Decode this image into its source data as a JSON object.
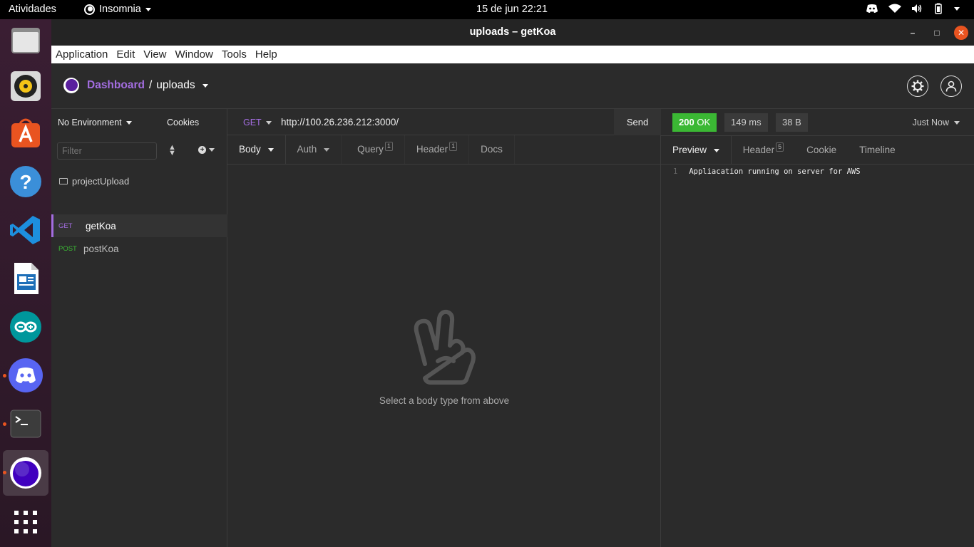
{
  "topbar": {
    "activities": "Atividades",
    "app_name": "Insomnia",
    "clock": "15 de jun  22:21"
  },
  "dock": {
    "items": [
      "files-icon",
      "rhythmbox-icon",
      "software-icon",
      "help-icon",
      "vscode-icon",
      "writer-icon",
      "arduino-icon",
      "discord-icon",
      "terminal-icon",
      "insomnia-icon",
      "apps-grid-icon"
    ]
  },
  "window": {
    "title": "uploads – getKoa"
  },
  "menubar": [
    "Application",
    "Edit",
    "View",
    "Window",
    "Tools",
    "Help"
  ],
  "header": {
    "dashboard": "Dashboard",
    "separator": "/",
    "workspace": "uploads"
  },
  "sidebar": {
    "environment": "No Environment",
    "cookies": "Cookies",
    "filter_placeholder": "Filter",
    "folder": "projectUpload",
    "requests": [
      {
        "method": "GET",
        "name": "getKoa",
        "color": "#a36de0"
      },
      {
        "method": "POST",
        "name": "postKoa",
        "color": "#3bb834"
      }
    ]
  },
  "request": {
    "method": "GET",
    "url": "http://100.26.236.212:3000/",
    "send": "Send",
    "tabs": {
      "body": "Body",
      "auth": "Auth",
      "query": "Query",
      "query_count": "1",
      "header": "Header",
      "header_count": "1",
      "docs": "Docs"
    },
    "empty_message": "Select a body type from above"
  },
  "response": {
    "status_code": "200",
    "status_text": "OK",
    "time": "149 ms",
    "size": "38 B",
    "when": "Just Now",
    "tabs": {
      "preview": "Preview",
      "header": "Header",
      "header_count": "5",
      "cookie": "Cookie",
      "timeline": "Timeline"
    },
    "line_number": "1",
    "body": "Appliacation running on server for AWS"
  },
  "colors": {
    "accent": "#a36de0",
    "status_ok": "#3bb834",
    "close": "#e95420"
  }
}
